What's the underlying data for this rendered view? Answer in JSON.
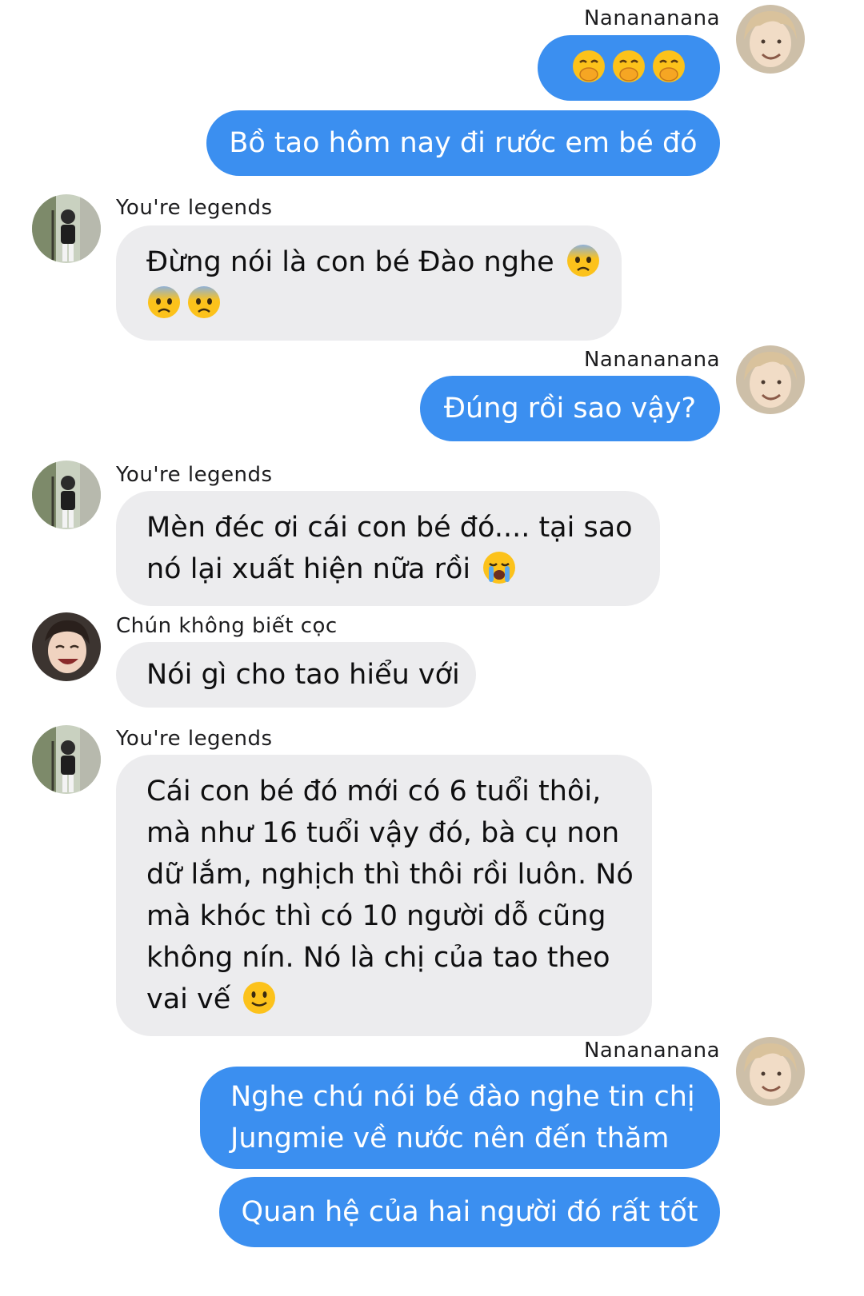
{
  "participants": {
    "me": "Nanananana",
    "legends": "You're legends",
    "chun": "Chún không biết cọc"
  },
  "icons": {
    "avatar_me": "avatar-blond-portrait",
    "avatar_legends": "avatar-standing-figure",
    "avatar_chun": "avatar-laughing-face",
    "emoji_hand_over_mouth": "face-with-hand-over-mouth-emoji",
    "emoji_fearful": "fearful-face-emoji",
    "emoji_crying": "loudly-crying-face-emoji",
    "emoji_smile": "slightly-smiling-face-emoji"
  },
  "colors": {
    "outgoing_bubble": "#3b8ff0",
    "incoming_bubble": "#ececee"
  },
  "messages": {
    "m2": "Bồ tao hôm nay đi rước em bé đó",
    "m3_line1": "Đừng nói là con bé Đào nghe",
    "m4": "Đúng rồi sao vậy?",
    "m5_line1": "Mèn đéc ơi cái con bé đó.... tại sao",
    "m5_line2": "nó lại xuất hiện nữa rồi",
    "m6": "Nói gì cho tao hiểu với",
    "m7_lines": [
      "Cái con bé đó mới có 6 tuổi thôi,",
      "mà như 16 tuổi vậy đó, bà cụ non",
      "dữ lắm, nghịch thì thôi rồi luôn. Nó",
      "mà khóc thì có 10 người dỗ cũng",
      "không nín. Nó là chị của tao theo",
      "vai vế"
    ],
    "m8_line1": "Nghe chú nói bé đào nghe tin chị",
    "m8_line2": "Jungmie về nước nên đến thăm",
    "m9": "Quan hệ của hai người đó rất tốt"
  }
}
